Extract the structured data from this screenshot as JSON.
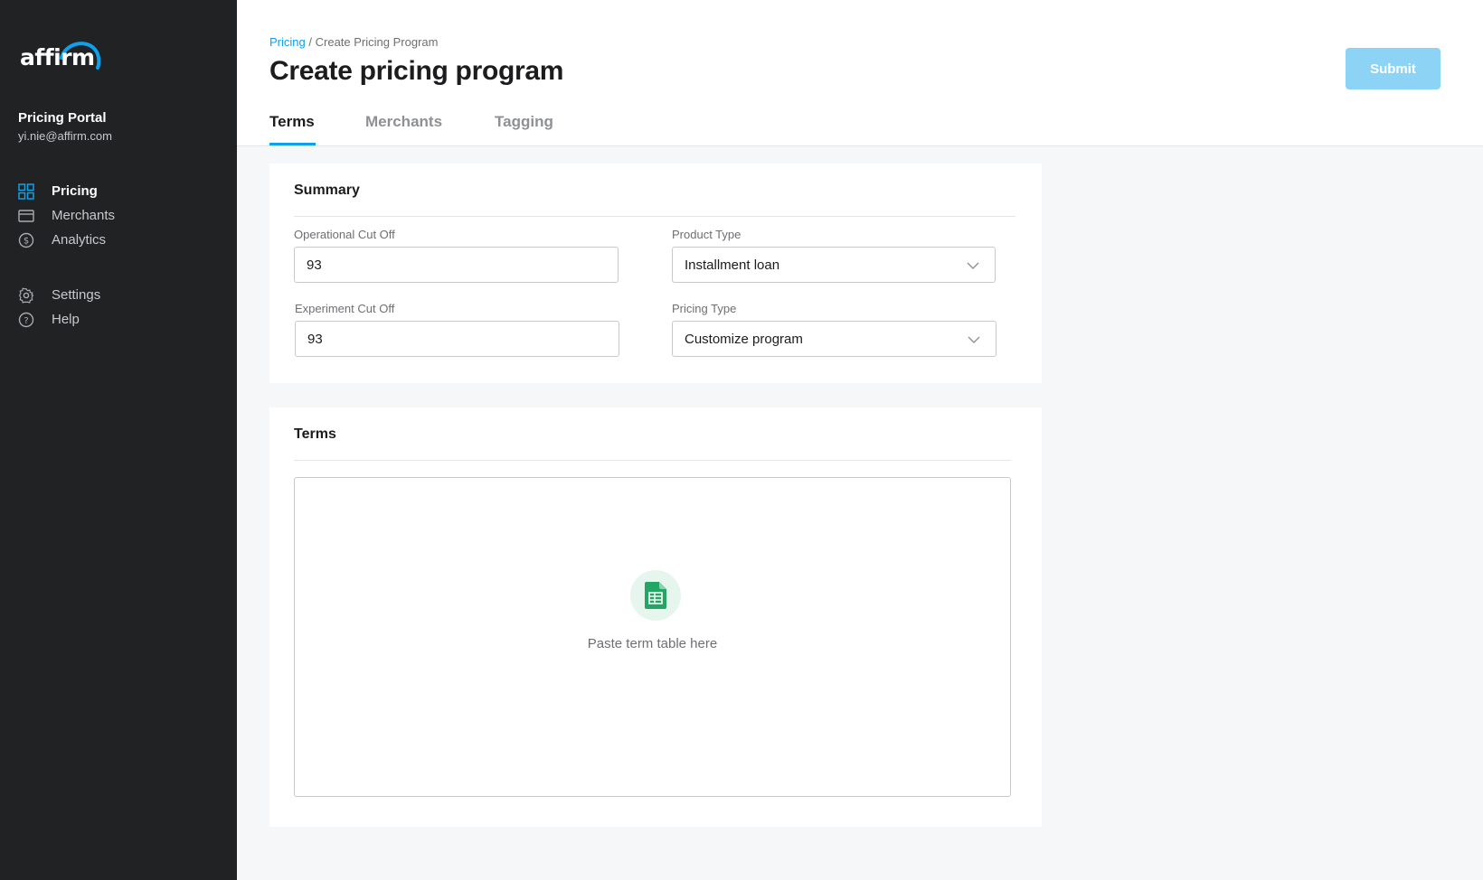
{
  "brand": {
    "logo_text": "affirm",
    "accent_color": "#0fa0ea"
  },
  "sidebar": {
    "portal_name": "Pricing Portal",
    "email": "yi.nie@affirm.com",
    "items": [
      {
        "label": "Pricing",
        "icon": "grid-icon",
        "active": true
      },
      {
        "label": "Merchants",
        "icon": "card-icon",
        "active": false
      },
      {
        "label": "Analytics",
        "icon": "dollar-circle-icon",
        "active": false
      },
      {
        "label": "Settings",
        "icon": "gear-icon",
        "active": false
      },
      {
        "label": "Help",
        "icon": "question-circle-icon",
        "active": false
      }
    ]
  },
  "header": {
    "breadcrumb": {
      "link": "Pricing",
      "separator": "/",
      "current": "Create Pricing Program"
    },
    "title": "Create pricing program",
    "submit_label": "Submit",
    "tabs": [
      {
        "label": "Terms",
        "active": true
      },
      {
        "label": "Merchants",
        "active": false
      },
      {
        "label": "Tagging",
        "active": false
      }
    ]
  },
  "summary": {
    "title": "Summary",
    "operational_cut_off": {
      "label": "Operational Cut Off",
      "value": "93"
    },
    "experiment_cut_off": {
      "label": "Experiment Cut Off",
      "value": "93"
    },
    "product_type": {
      "label": "Product Type",
      "value": "Installment loan"
    },
    "pricing_type": {
      "label": "Pricing Type",
      "value": "Customize program"
    }
  },
  "terms": {
    "title": "Terms",
    "paste_label": "Paste term table here",
    "icon": "spreadsheet-icon"
  }
}
